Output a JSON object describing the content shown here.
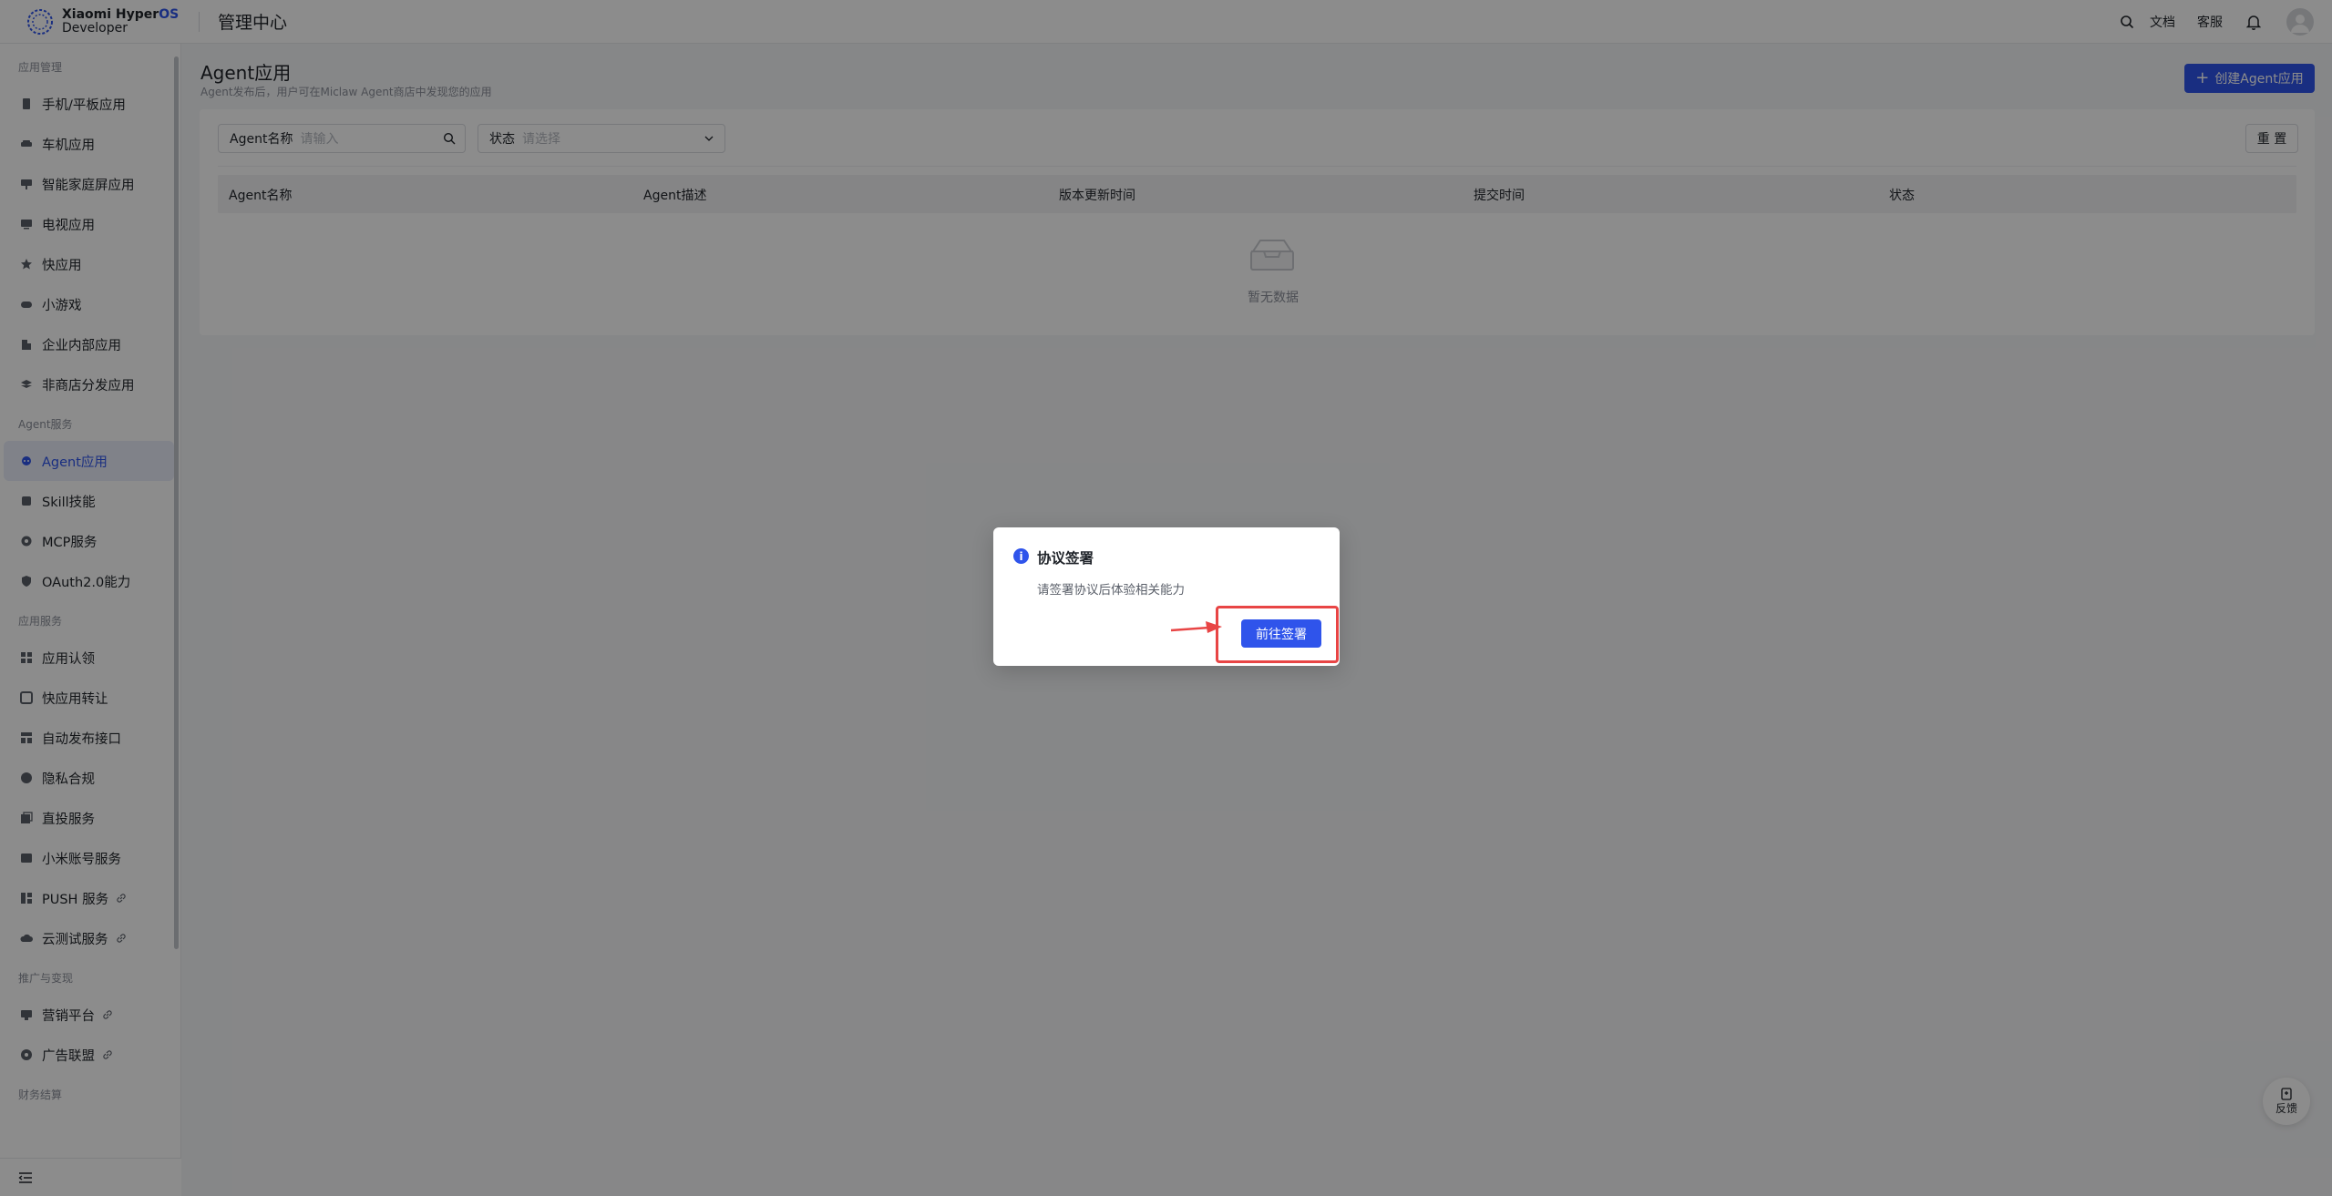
{
  "header": {
    "logo_line1": "Xiaomi Hyper",
    "logo_os": "OS",
    "logo_line2": "Developer",
    "title": "管理中心",
    "docs": "文档",
    "support": "客服"
  },
  "sidebar": {
    "groups": [
      {
        "label": "应用管理",
        "items": [
          {
            "label": "手机/平板应用",
            "icon": "phone-icon"
          },
          {
            "label": "车机应用",
            "icon": "car-icon"
          },
          {
            "label": "智能家庭屏应用",
            "icon": "home-screen-icon"
          },
          {
            "label": "电视应用",
            "icon": "tv-icon"
          },
          {
            "label": "快应用",
            "icon": "star-icon"
          },
          {
            "label": "小游戏",
            "icon": "game-icon"
          },
          {
            "label": "企业内部应用",
            "icon": "building-icon"
          },
          {
            "label": "非商店分发应用",
            "icon": "stack-icon"
          }
        ]
      },
      {
        "label": "Agent服务",
        "items": [
          {
            "label": "Agent应用",
            "icon": "agent-icon",
            "active": true
          },
          {
            "label": "Skill技能",
            "icon": "puzzle-icon"
          },
          {
            "label": "MCP服务",
            "icon": "mcp-icon"
          },
          {
            "label": "OAuth2.0能力",
            "icon": "shield-icon"
          }
        ]
      },
      {
        "label": "应用服务",
        "items": [
          {
            "label": "应用认领",
            "icon": "claim-icon"
          },
          {
            "label": "快应用转让",
            "icon": "transfer-icon"
          },
          {
            "label": "自动发布接口",
            "icon": "api-icon"
          },
          {
            "label": "隐私合规",
            "icon": "privacy-icon"
          },
          {
            "label": "直投服务",
            "icon": "delivery-icon"
          },
          {
            "label": "小米账号服务",
            "icon": "account-icon"
          },
          {
            "label": "PUSH 服务",
            "icon": "push-icon",
            "external": true
          },
          {
            "label": "云测试服务",
            "icon": "cloud-icon",
            "external": true
          }
        ]
      },
      {
        "label": "推广与变现",
        "items": [
          {
            "label": "营销平台",
            "icon": "marketing-icon",
            "external": true
          },
          {
            "label": "广告联盟",
            "icon": "ad-icon",
            "external": true
          }
        ]
      },
      {
        "label": "财务结算",
        "items": []
      }
    ]
  },
  "main": {
    "title": "Agent应用",
    "subtitle": "Agent发布后，用户可在Miclaw Agent商店中发现您的应用",
    "create_button": "创建Agent应用",
    "filter_name_label": "Agent名称",
    "filter_name_placeholder": "请输入",
    "filter_status_label": "状态",
    "filter_status_placeholder": "请选择",
    "reset_button": "重 置",
    "table_headers": [
      "Agent名称",
      "Agent描述",
      "版本更新时间",
      "提交时间",
      "状态"
    ],
    "empty_text": "暂无数据"
  },
  "dialog": {
    "title": "协议签署",
    "content": "请签署协议后体验相关能力",
    "button": "前往签署"
  },
  "feedback": {
    "label": "反馈"
  },
  "colors": {
    "brand": "#2f54eb",
    "annotation": "#e84545",
    "overlay": "rgba(0,0,0,0.45)"
  }
}
